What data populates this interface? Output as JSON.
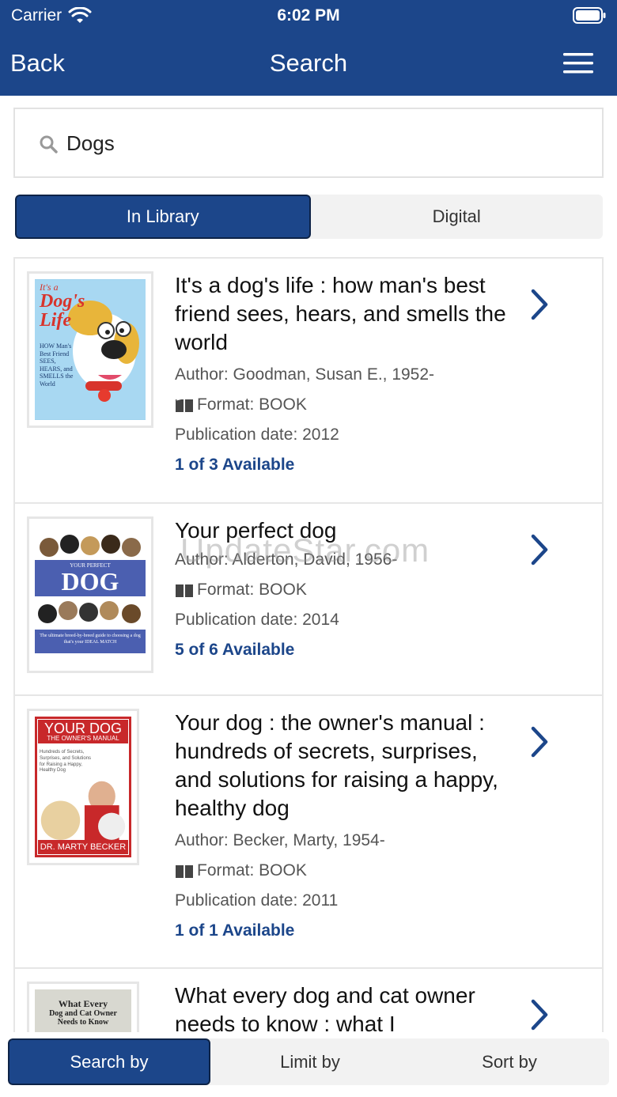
{
  "status_bar": {
    "carrier": "Carrier",
    "time": "6:02 PM"
  },
  "nav": {
    "back_label": "Back",
    "title": "Search",
    "menu_icon": "hamburger-menu-icon"
  },
  "search": {
    "value": "Dogs",
    "icon": "search-icon"
  },
  "segments": [
    {
      "label": "In Library",
      "active": true
    },
    {
      "label": "Digital",
      "active": false
    }
  ],
  "results": [
    {
      "title": "It's a dog's life : how man's best friend sees, hears, and smells the world",
      "author": "Author: Goodman, Susan E., 1952-",
      "format": "Format: BOOK",
      "pubdate": "Publication date: 2012",
      "availability": "1 of 3 Available",
      "cover": {
        "line1": "It's a",
        "line2": "Dog's",
        "line3": "Life",
        "sub": "HOW Man's Best Friend SEES, HEARS, and SMELLS the World"
      }
    },
    {
      "title": "Your perfect dog",
      "author": "Author: Alderton, David, 1956-",
      "format": "Format: BOOK",
      "pubdate": "Publication date: 2014",
      "availability": "5 of 6 Available",
      "cover": {
        "line1": "YOUR PERFECT",
        "line2": "DOG",
        "sub": "The ultimate breed-by-breed guide to choosing a dog that's your IDEAL MATCH"
      }
    },
    {
      "title": "Your dog : the owner's manual : hundreds of secrets, surprises, and solutions for raising a happy, healthy dog",
      "author": "Author: Becker, Marty, 1954-",
      "format": "Format: BOOK",
      "pubdate": "Publication date: 2011",
      "availability": "1 of 1 Available",
      "cover": {
        "line1": "YOUR DOG",
        "line2": "THE OWNER'S MANUAL",
        "sub": "Hundreds of Secrets, Surprises, and Solutions for Raising a Happy, Healthy Dog",
        "author": "DR. MARTY BECKER"
      }
    },
    {
      "title": "What every dog and cat owner needs to know : what I",
      "cover": {
        "line1": "What Every",
        "line2": "Dog and Cat Owner",
        "line3": "Needs to Know"
      }
    }
  ],
  "watermark": "UpdateStar.com",
  "bottom_tabs": [
    {
      "label": "Search by",
      "active": true
    },
    {
      "label": "Limit by",
      "active": false
    },
    {
      "label": "Sort by",
      "active": false
    }
  ],
  "colors": {
    "brand": "#1c468a",
    "link": "#1c468a",
    "border": "#e6e6e6"
  }
}
